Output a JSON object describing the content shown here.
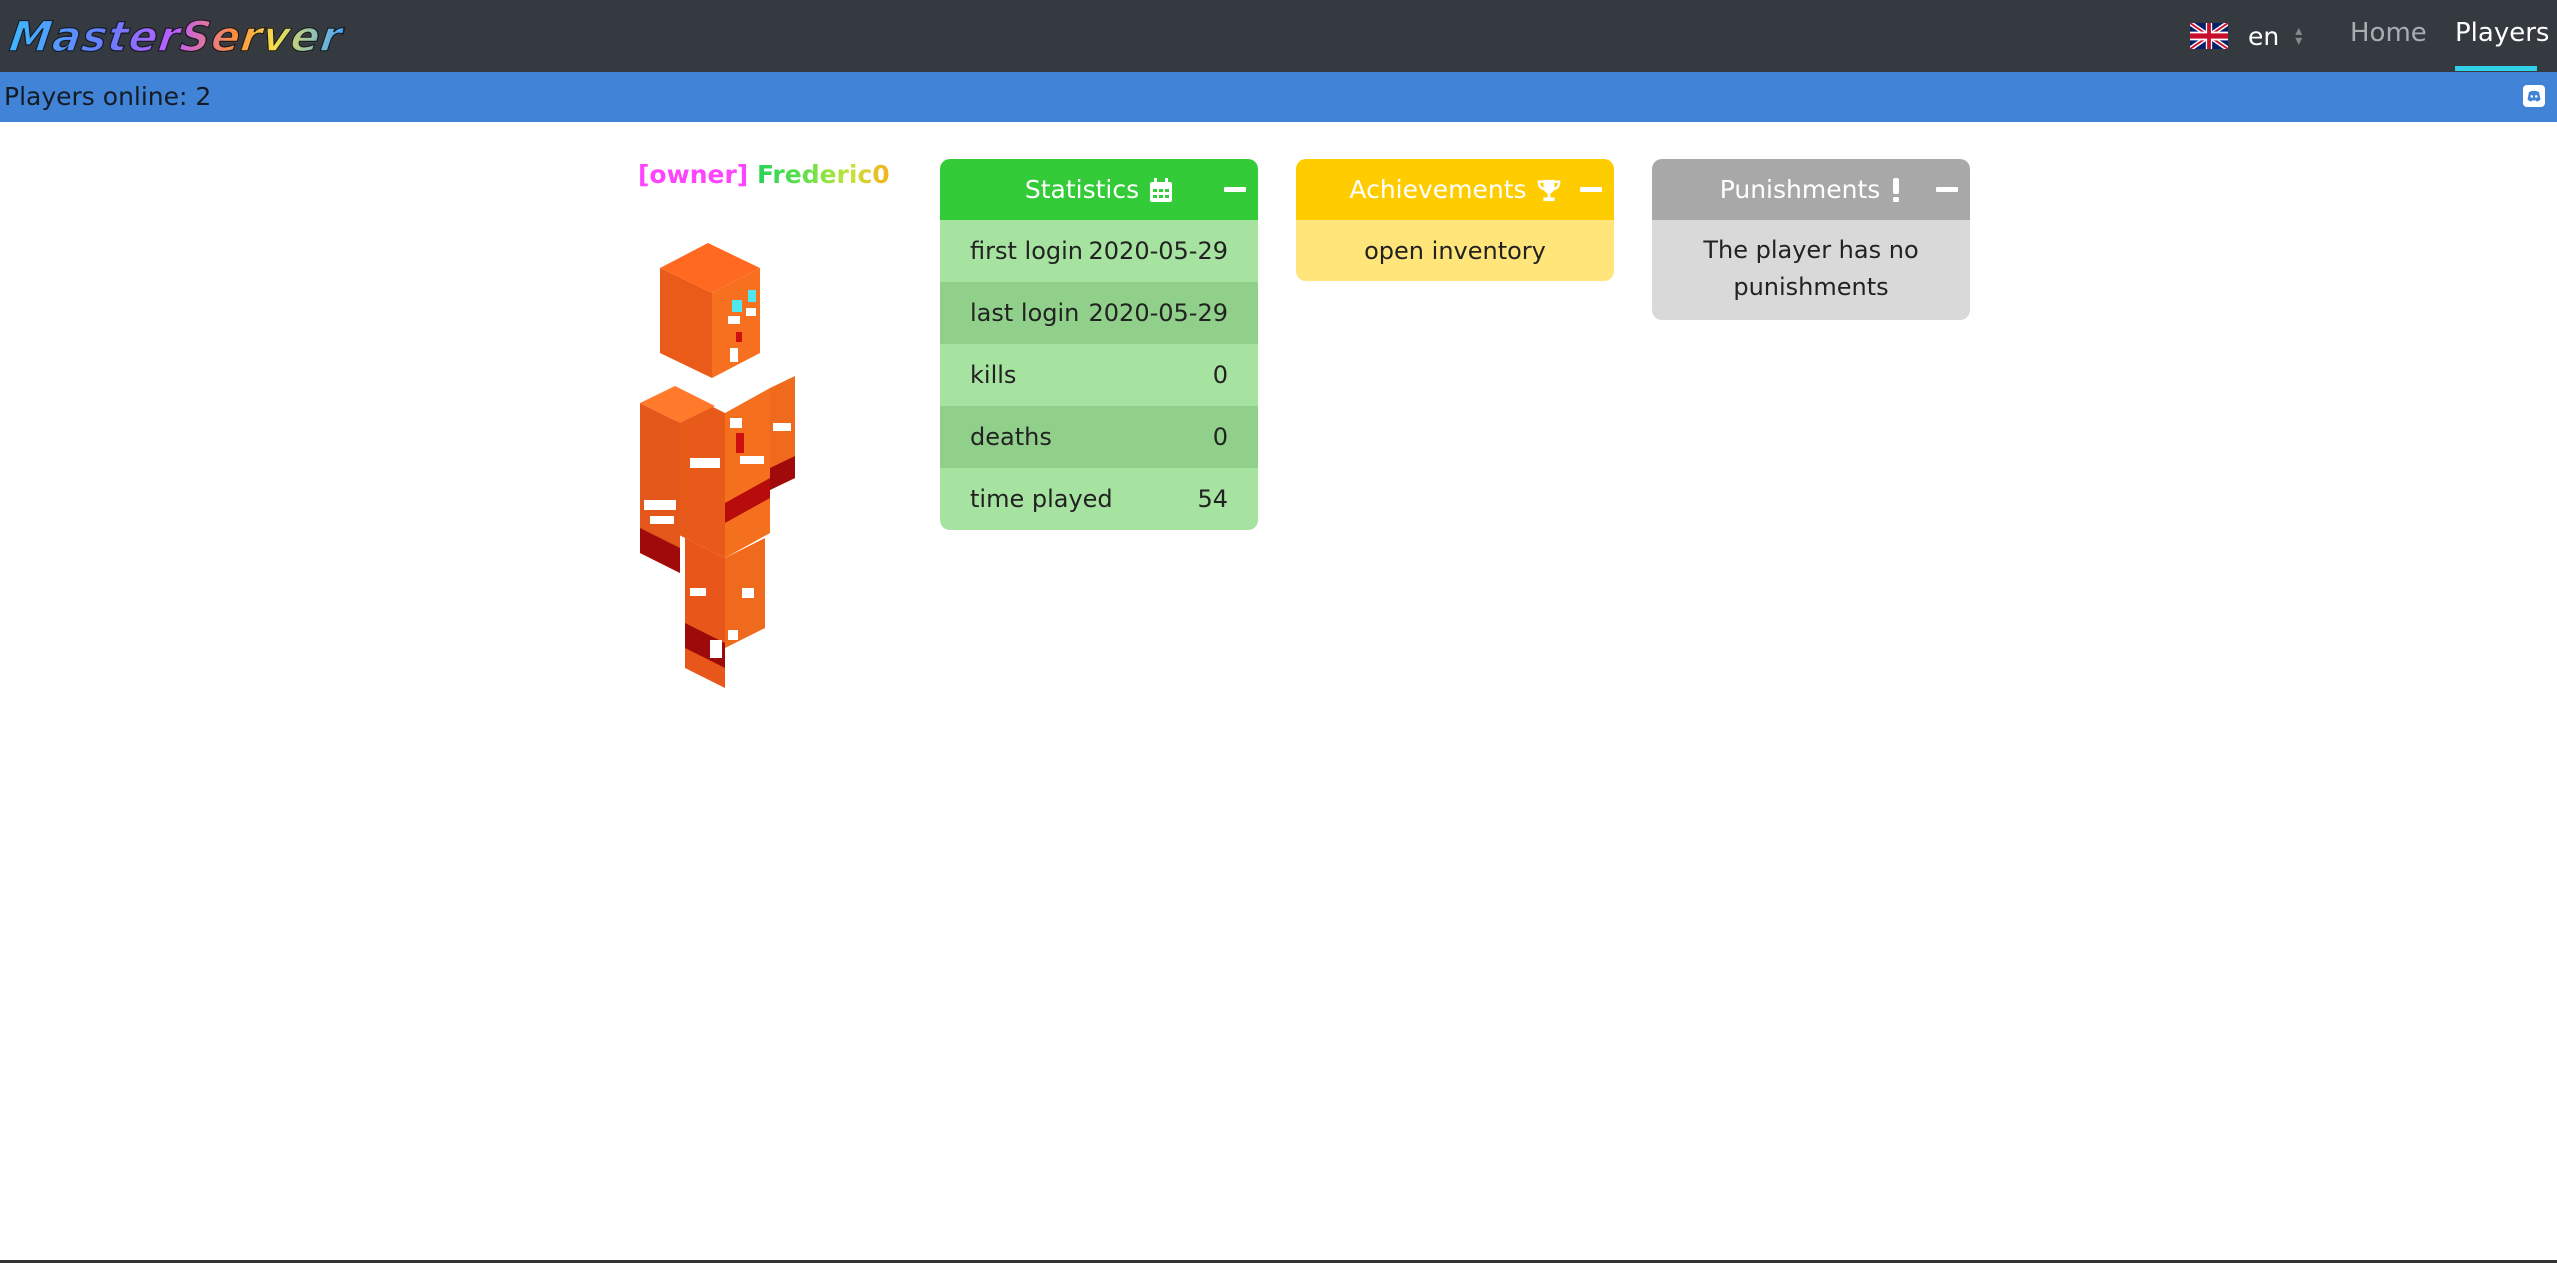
{
  "navbar": {
    "logo_text": "MasterServer",
    "language": {
      "flag_icon": "uk-flag-icon",
      "label": "en"
    },
    "links": [
      {
        "label": "Home",
        "active": false
      },
      {
        "label": "Players",
        "active": true
      }
    ],
    "active_color": "#2fd0e8"
  },
  "online_bar": {
    "text": "Players online: 2",
    "discord_icon": "discord-icon",
    "color": "#4183d6"
  },
  "player": {
    "rank": "[owner]",
    "name": "Frederic0",
    "rank_color": "#ff44ff"
  },
  "statistics": {
    "title": "Statistics",
    "icon": "calendar-icon",
    "color": "#33cc38",
    "rows": [
      {
        "label": "first login",
        "value": "2020-05-29"
      },
      {
        "label": "last login",
        "value": "2020-05-29"
      },
      {
        "label": "kills",
        "value": "0"
      },
      {
        "label": "deaths",
        "value": "0"
      },
      {
        "label": "time played",
        "value": "54"
      }
    ]
  },
  "achievements": {
    "title": "Achievements",
    "icon": "trophy-icon",
    "color": "#ffcc00",
    "action": "open inventory"
  },
  "punishments": {
    "title": "Punishments",
    "icon": "exclamation-icon",
    "color": "#a8a8a8",
    "message": "The player has no punishments"
  }
}
